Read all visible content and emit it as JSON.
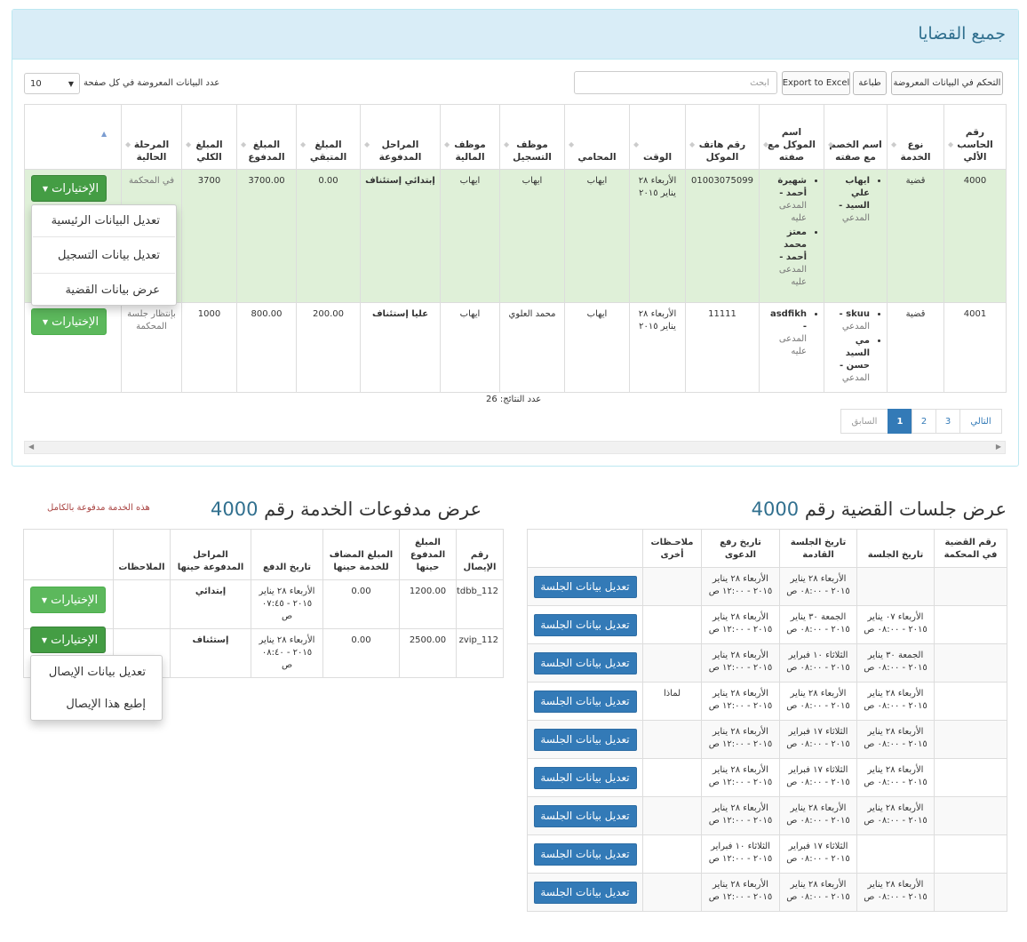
{
  "cases_panel": {
    "title": "جميع القضايا",
    "buttons": {
      "column_control": "التحكم في البيانات المعروضة",
      "print": "طباعة",
      "export_excel": "Export to Excel"
    },
    "search_placeholder": "ابحث",
    "page_size_label": "عدد البيانات المعروضة في كل صفحة",
    "page_size_value": "10",
    "columns": [
      "رقم الحاسب الألي",
      "نوع الخدمة",
      "اسم الخصم مع صفته",
      "اسم الموكل مع صفته",
      "رقم هاتف الموكل",
      "الوقت",
      "المحامي",
      "موظف التسجيل",
      "موظف المالية",
      "المراحل المدفوعة",
      "المبلغ المتبقي",
      "المبلغ المدفوع",
      "المبلغ الكلي",
      "المرحلة الحالية",
      ""
    ],
    "rows": [
      {
        "computer_no": "4000",
        "service_type": "قضية",
        "opponent": [
          {
            "name": "ايهاب علي السيد -",
            "role": "المدعي"
          }
        ],
        "client": [
          {
            "name": "شهيرة أحمد -",
            "role": "المدعى عليه"
          },
          {
            "name": "معتز محمد أحمد -",
            "role": "المدعى عليه"
          }
        ],
        "client_phone": "01003075099",
        "time": "الأربعاء ٢٨ يناير ٢٠١٥",
        "lawyer": "ايهاب",
        "registration_employee": "ايهاب",
        "finance_employee": "ايهاب",
        "paid_stages": "إبتدائي إستئناف",
        "remaining": "0.00",
        "paid": "3700.00",
        "total": "3700",
        "current_stage": "في المحكمة"
      },
      {
        "computer_no": "4001",
        "service_type": "قضية",
        "opponent": [
          {
            "name": "skuu -",
            "role": "المدعي"
          },
          {
            "name": "مي السيد حسن -",
            "role": "المدعي"
          }
        ],
        "client": [
          {
            "name": "asdfikh -",
            "role": "المدعى عليه"
          }
        ],
        "client_phone": "11111",
        "time": "الأربعاء ٢٨ يناير ٢٠١٥",
        "lawyer": "ايهاب",
        "registration_employee": "محمد العلوي",
        "finance_employee": "ايهاب",
        "paid_stages": "عليا إستئناف",
        "remaining": "200.00",
        "paid": "800.00",
        "total": "1000",
        "current_stage": "بإنتظار جلسة المحكمة"
      }
    ],
    "options_label": "الإختيارات",
    "row_dropdown": [
      "تعديل البيانات الرئيسية",
      "تعديل بيانات التسجيل",
      "عرض بيانات القضية"
    ],
    "results_count": "عدد النتائج: 26",
    "pagination": {
      "next": "التالي",
      "prev": "السابق",
      "pages": [
        "3",
        "2",
        "1"
      ]
    }
  },
  "sessions": {
    "title_prefix": "عرض جلسات القضية رقم",
    "case_no": "4000",
    "columns": [
      "رقم القضية في المحكمة",
      "تاريخ الجلسة",
      "تاريخ الجلسة القادمة",
      "تاريخ رفع الدعوى",
      "ملاحـظات أخرى",
      ""
    ],
    "edit_label": "تعديل بيانات الجلسة",
    "rows": [
      {
        "court_no": "",
        "date": "",
        "next": "الأربعاء ٢٨ يناير ٢٠١٥ - ٠٨:٠٠ ص",
        "filed": "الأربعاء ٢٨ يناير ٢٠١٥ - ١٢:٠٠ ص",
        "notes": ""
      },
      {
        "court_no": "",
        "date": "الأربعاء ٠٧ يناير ٢٠١٥ - ٠٨:٠٠ ص",
        "next": "الجمعة ٣٠ يناير ٢٠١٥ - ٠٨:٠٠ ص",
        "filed": "الأربعاء ٢٨ يناير ٢٠١٥ - ١٢:٠٠ ص",
        "notes": ""
      },
      {
        "court_no": "",
        "date": "الجمعة ٣٠ يناير ٢٠١٥ - ٠٨:٠٠ ص",
        "next": "الثلاثاء ١٠ فبراير ٢٠١٥ - ٠٨:٠٠ ص",
        "filed": "الأربعاء ٢٨ يناير ٢٠١٥ - ١٢:٠٠ ص",
        "notes": ""
      },
      {
        "court_no": "",
        "date": "الأربعاء ٢٨ يناير ٢٠١٥ - ٠٨:٠٠ ص",
        "next": "الأربعاء ٢٨ يناير ٢٠١٥ - ٠٨:٠٠ ص",
        "filed": "الأربعاء ٢٨ يناير ٢٠١٥ - ١٢:٠٠ ص",
        "notes": "لماذا"
      },
      {
        "court_no": "",
        "date": "الأربعاء ٢٨ يناير ٢٠١٥ - ٠٨:٠٠ ص",
        "next": "الثلاثاء ١٧ فبراير ٢٠١٥ - ٠٨:٠٠ ص",
        "filed": "الأربعاء ٢٨ يناير ٢٠١٥ - ١٢:٠٠ ص",
        "notes": ""
      },
      {
        "court_no": "",
        "date": "الأربعاء ٢٨ يناير ٢٠١٥ - ٠٨:٠٠ ص",
        "next": "الثلاثاء ١٧ فبراير ٢٠١٥ - ٠٨:٠٠ ص",
        "filed": "الأربعاء ٢٨ يناير ٢٠١٥ - ١٢:٠٠ ص",
        "notes": ""
      },
      {
        "court_no": "",
        "date": "الأربعاء ٢٨ يناير ٢٠١٥ - ٠٨:٠٠ ص",
        "next": "الأربعاء ٢٨ يناير ٢٠١٥ - ٠٨:٠٠ ص",
        "filed": "الأربعاء ٢٨ يناير ٢٠١٥ - ١٢:٠٠ ص",
        "notes": ""
      },
      {
        "court_no": "",
        "date": "",
        "next": "الثلاثاء ١٧ فبراير ٢٠١٥ - ٠٨:٠٠ ص",
        "filed": "الثلاثاء ١٠ فبراير ٢٠١٥ - ١٢:٠٠ ص",
        "notes": ""
      },
      {
        "court_no": "",
        "date": "الأربعاء ٢٨ يناير ٢٠١٥ - ٠٨:٠٠ ص",
        "next": "الأربعاء ٢٨ يناير ٢٠١٥ - ٠٨:٠٠ ص",
        "filed": "الأربعاء ٢٨ يناير ٢٠١٥ - ١٢:٠٠ ص",
        "notes": ""
      }
    ]
  },
  "payments": {
    "title_prefix": "عرض مدفوعات الخدمة رقم",
    "service_no": "4000",
    "fully_paid_note": "هذه الخدمة مدفوعة بالكامل",
    "columns": [
      "رقم الإيصال",
      "المبلغ المدفوع حينها",
      "المبلغ المضاف للخدمة حينها",
      "تاريخ الدفع",
      "المراحل المدفوعة حينها",
      "الملاحظات",
      ""
    ],
    "rows": [
      {
        "receipt_no": "112_tdbb",
        "paid": "1200.00",
        "added": "0.00",
        "date": "الأربعاء ٢٨ يناير ٢٠١٥ - ٠٧:٤٥ ص",
        "stages": "إبتدائي",
        "notes": ""
      },
      {
        "receipt_no": "112_zvip",
        "paid": "2500.00",
        "added": "0.00",
        "date": "الأربعاء ٢٨ يناير ٢٠١٥ - ٠٨:٤٠ ص",
        "stages": "إستئناف",
        "notes": ""
      }
    ],
    "options_label": "الإختيارات",
    "row_dropdown": [
      "تعديل بيانات الإيصال",
      "إطبع هذا الإيصال"
    ]
  },
  "colors": {
    "panel_heading": "#d9edf7",
    "active_row": "#dff0d8",
    "success": "#5cb85c",
    "primary": "#337ab7",
    "note": "#a94442"
  }
}
